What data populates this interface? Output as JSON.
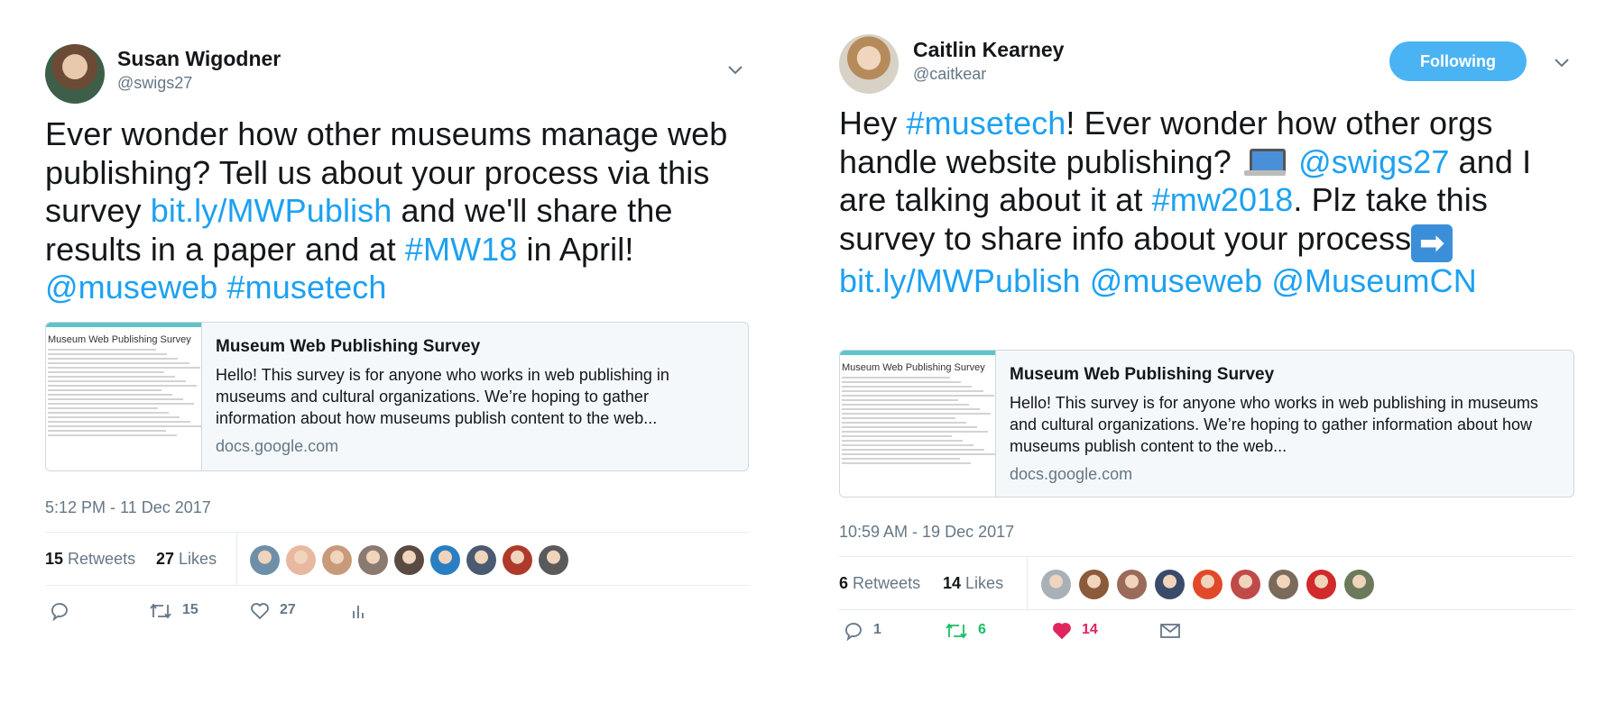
{
  "tweet_left": {
    "name": "Susan Wigodner",
    "handle": "@swigs27",
    "text_segments": [
      {
        "t": "Ever wonder how other museums manage web publishing? Tell us about your process via this survey ",
        "link": false
      },
      {
        "t": "bit.ly/MWPublish",
        "link": true
      },
      {
        "t": " and we'll share the results in a paper and at ",
        "link": false
      },
      {
        "t": "#MW18",
        "link": true
      },
      {
        "t": " in April! ",
        "link": false
      },
      {
        "t": "@museweb",
        "link": true
      },
      {
        "t": " ",
        "link": false
      },
      {
        "t": "#musetech",
        "link": true
      }
    ],
    "card": {
      "thumb_title": "Museum Web Publishing Survey",
      "title": "Museum Web Publishing Survey",
      "description": "Hello! This survey is for anyone who works in web publishing in museums and cultural organizations. We’re hoping to gather information about how museums publish content to the web...",
      "domain": "docs.google.com"
    },
    "timestamp": "5:12 PM - 11 Dec 2017",
    "stats": {
      "retweets_count": "15",
      "retweets_label": "Retweets",
      "likes_count": "27",
      "likes_label": "Likes"
    },
    "actions": {
      "reply_count": "",
      "retweet_count": "15",
      "like_count": "27"
    },
    "likers": [
      "#6e8fa8",
      "#e8b8a0",
      "#c99a7a",
      "#8a7a70",
      "#5a4a44",
      "#2a7fc2",
      "#4a5a70",
      "#b03a2a",
      "#5a5a5a"
    ]
  },
  "tweet_right": {
    "name": "Caitlin Kearney",
    "handle": "@caitkear",
    "follow_label": "Following",
    "text_segments": [
      {
        "t": "Hey ",
        "link": false
      },
      {
        "t": "#musetech",
        "link": true
      },
      {
        "t": "! Ever wonder how other orgs handle website publishing? ",
        "link": false
      },
      {
        "t": "[laptop]",
        "emoji": "laptop"
      },
      {
        "t": " ",
        "link": false
      },
      {
        "t": "@swigs27",
        "link": true
      },
      {
        "t": " and I are talking about it at ",
        "link": false
      },
      {
        "t": "#mw2018",
        "link": true
      },
      {
        "t": ". Plz take this survey to share info about your process",
        "link": false
      },
      {
        "t": "[arrow]",
        "emoji": "arrow"
      },
      {
        "t": " ",
        "link": false
      },
      {
        "t": "bit.ly/MWPublish",
        "link": true
      },
      {
        "t": " ",
        "link": false
      },
      {
        "t": "@museweb",
        "link": true
      },
      {
        "t": " ",
        "link": false
      },
      {
        "t": "@MuseumCN",
        "link": true
      }
    ],
    "card": {
      "thumb_title": "Museum Web Publishing Survey",
      "title": "Museum Web Publishing Survey",
      "description": "Hello! This survey is for anyone who works in web publishing in museums and cultural organizations. We’re hoping to gather information about how museums publish content to the web...",
      "domain": "docs.google.com"
    },
    "timestamp": "10:59 AM - 19 Dec 2017",
    "stats": {
      "retweets_count": "6",
      "retweets_label": "Retweets",
      "likes_count": "14",
      "likes_label": "Likes"
    },
    "actions": {
      "reply_count": "1",
      "retweet_count": "6",
      "like_count": "14"
    },
    "likers": [
      "#a8b0b8",
      "#8a5a3a",
      "#9a6a5a",
      "#3a4a6a",
      "#e04a2a",
      "#c04a4a",
      "#7a6a5a",
      "#d02a2a",
      "#6a7a5a"
    ],
    "liker_text_logos": [
      "mcn",
      "mus"
    ]
  },
  "colors": {
    "link": "#1da1f2",
    "follow_bg": "#4ab3f4",
    "retweet_green": "#17bf63",
    "like_red": "#e0245e",
    "muted": "#657786"
  }
}
